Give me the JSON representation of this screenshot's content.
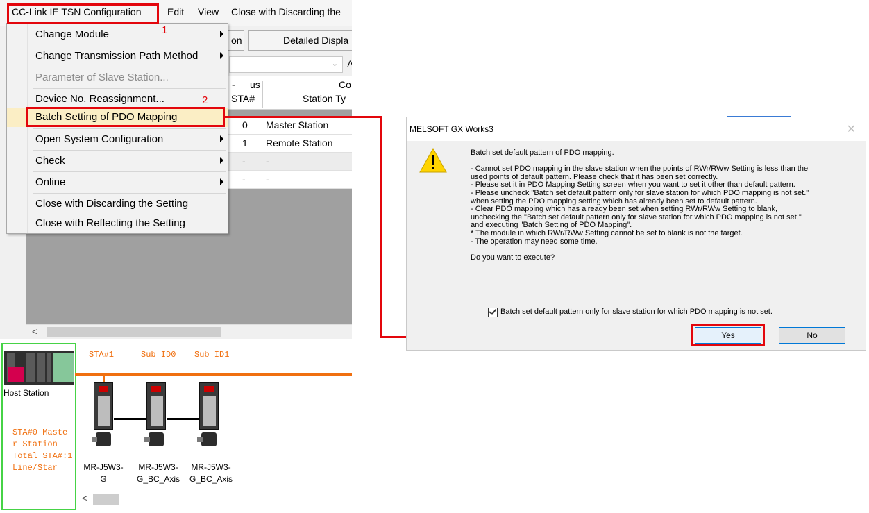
{
  "menubar": {
    "items": [
      "CC-Link IE TSN Configuration",
      "Edit",
      "View",
      "Close with Discarding the"
    ]
  },
  "toolbar": {
    "button1": "on",
    "button2": "Detailed Displa",
    "filter_trailing": "A"
  },
  "menu": {
    "items": [
      {
        "label": "Change Module",
        "submenu": true,
        "enabled": true
      },
      {
        "label": "Change Transmission Path Method",
        "submenu": true,
        "enabled": true
      },
      {
        "label": "Parameter of Slave Station...",
        "submenu": false,
        "enabled": false
      },
      {
        "label": "Device No. Reassignment...",
        "submenu": false,
        "enabled": true
      },
      {
        "label": "Batch Setting of PDO Mapping",
        "submenu": false,
        "enabled": true,
        "highlighted": true
      },
      {
        "label": "Open System Configuration",
        "submenu": true,
        "enabled": true
      },
      {
        "label": "Check",
        "submenu": true,
        "enabled": true
      },
      {
        "label": "Online",
        "submenu": true,
        "enabled": true
      },
      {
        "label": "Close with Discarding the Setting",
        "submenu": false,
        "enabled": true
      },
      {
        "label": "Close with Reflecting the Setting",
        "submenu": false,
        "enabled": true
      }
    ]
  },
  "annotations": {
    "step1": "1",
    "step2": "2"
  },
  "grid": {
    "headers": {
      "status_frag": "us",
      "dash": "-",
      "sta": "STA#",
      "co_frag": "Co",
      "station_type": "Station Ty"
    },
    "rows": [
      {
        "sta": "0",
        "type": "Master Station"
      },
      {
        "sta": "1",
        "type": "Remote Station"
      },
      {
        "sta": "-",
        "type": "-"
      },
      {
        "sta": "-",
        "type": "-"
      }
    ]
  },
  "diagram": {
    "host_label": "Host Station",
    "host_info": [
      "STA#0  Maste",
      "r Station",
      "Total STA#:1",
      "Line/Star"
    ],
    "sta_label": "STA#1",
    "sub_labels": [
      "Sub ID0",
      "Sub ID1"
    ],
    "devices": [
      {
        "line1": "MR-J5W3-",
        "line2": "G"
      },
      {
        "line1": "MR-J5W3-",
        "line2": "G_BC_Axis"
      },
      {
        "line1": "MR-J5W3-",
        "line2": "G_BC_Axis"
      }
    ]
  },
  "dialog": {
    "title": "MELSOFT GX Works3",
    "close_glyph": "✕",
    "paragraphs": [
      "Batch set default pattern of PDO mapping.",
      "",
      "- Cannot set PDO mapping in the slave station when the points of RWr/RWw Setting is less than the",
      "used points of default pattern. Please check that it has been set correctly.",
      "- Please set it in PDO Mapping Setting screen when you want to set it other than default pattern.",
      "- Please uncheck \"Batch set default pattern only for slave station for which PDO mapping is not set.\"",
      "when setting the PDO mapping setting which has already been set to default pattern.",
      "- Clear PDO mapping which has already been set when setting RWr/RWw Setting to blank,",
      "unchecking the \"Batch set default pattern only for slave station for which PDO mapping is not set.\"",
      "and executing \"Batch Setting of PDO Mapping\".",
      "* The module in which RWr/RWw Setting cannot be set to blank is not the target.",
      "- The operation may need some time.",
      "",
      "Do you want to execute?"
    ],
    "checkbox_label": "Batch set default pattern only for slave station for which PDO mapping is not set.",
    "checkbox_checked": true,
    "yes_label": "Yes",
    "no_label": "No"
  },
  "colors": {
    "annotation_red": "#e3060c",
    "network_orange": "#f07010",
    "host_green": "#46d346",
    "highlight": "#fbeec5"
  }
}
